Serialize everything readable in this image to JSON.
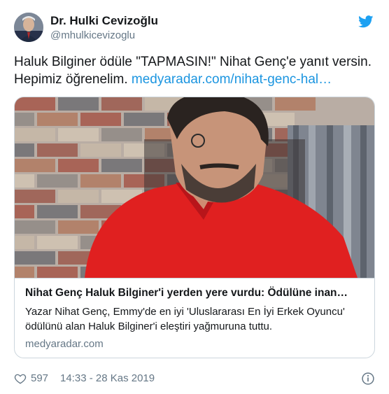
{
  "author": {
    "display_name": "Dr. Hulki Cevizoğlu",
    "handle": "@mhulkicevizoglu",
    "avatar_icon": "avatar-photo"
  },
  "tweet": {
    "text": "Haluk Bilginer ödüle \"TAPMASIN!\" Nihat Genç'e yanıt versin. Hepimiz öğrenelim.",
    "link_text": "medyaradar.com/nihat-genc-hal…"
  },
  "card": {
    "title": "Nihat Genç Haluk Bilginer'i yerden yere vurdu: Ödülüne inan…",
    "description": "Yazar Nihat Genç, Emmy'de en iyi 'Uluslararası En İyi Erkek Oyuncu' ödülünü alan Haluk Bilginer'i eleştiri yağmuruna tuttu.",
    "domain": "medyaradar.com"
  },
  "footer": {
    "like_count": "597",
    "timestamp": "14:33 - 28 Kas 2019"
  },
  "colors": {
    "link": "#1b95e0",
    "secondary_text": "#657786",
    "border": "#ccd6dd",
    "shirt_red": "#e02020"
  }
}
